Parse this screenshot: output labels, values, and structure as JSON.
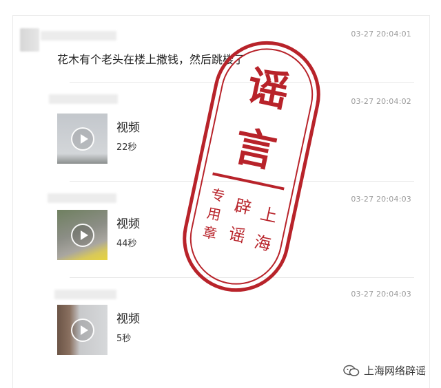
{
  "messages": [
    {
      "time": "03-27 20:04:01",
      "text": "花木有个老头在楼上撒钱，然后跳楼了"
    },
    {
      "time": "03-27 20:04:02",
      "video_label": "视频",
      "duration": "22秒"
    },
    {
      "time": "03-27 20:04:03",
      "video_label": "视频",
      "duration": "44秒"
    },
    {
      "time": "03-27 20:04:03",
      "video_label": "视频",
      "duration": "5秒"
    }
  ],
  "stamp": {
    "title_top": "谣",
    "title_bottom": "言",
    "left_col_1": "专",
    "left_col_2": "用",
    "left_col_3": "章",
    "mid_col_1": "辟",
    "mid_col_2": "谣",
    "right_col_1": "上",
    "right_col_2": "海",
    "color": "#b8232a"
  },
  "footer": {
    "account_name": "上海网络辟谣"
  }
}
